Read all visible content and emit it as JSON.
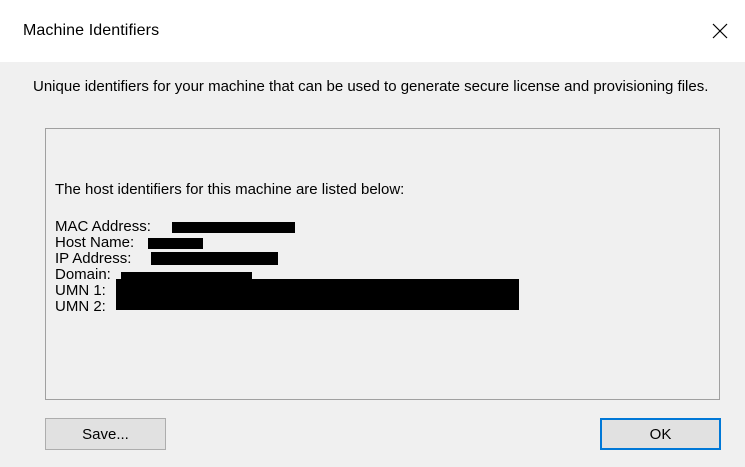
{
  "window": {
    "title": "Machine Identifiers",
    "close_glyph": "✕"
  },
  "description": "Unique identifiers for your machine that can be used to generate secure license and provisioning files.",
  "info": {
    "intro": "The host identifiers for this machine are listed below:",
    "rows": [
      {
        "label": "MAC Address:",
        "value": ""
      },
      {
        "label": "Host Name:",
        "value": ""
      },
      {
        "label": "IP Address:",
        "value": ""
      },
      {
        "label": "Domain:",
        "value": ""
      },
      {
        "label": "UMN 1:",
        "value": ""
      },
      {
        "label": "UMN 2:",
        "value": ""
      }
    ]
  },
  "buttons": {
    "save_label": "Save...",
    "ok_label": "OK"
  },
  "colors": {
    "dialog_bg": "#f0f0f0",
    "titlebar_bg": "#ffffff",
    "button_bg": "#e1e1e1",
    "default_button_border": "#0078d7",
    "redaction": "#000000"
  },
  "icons": {
    "close": "close-icon"
  }
}
